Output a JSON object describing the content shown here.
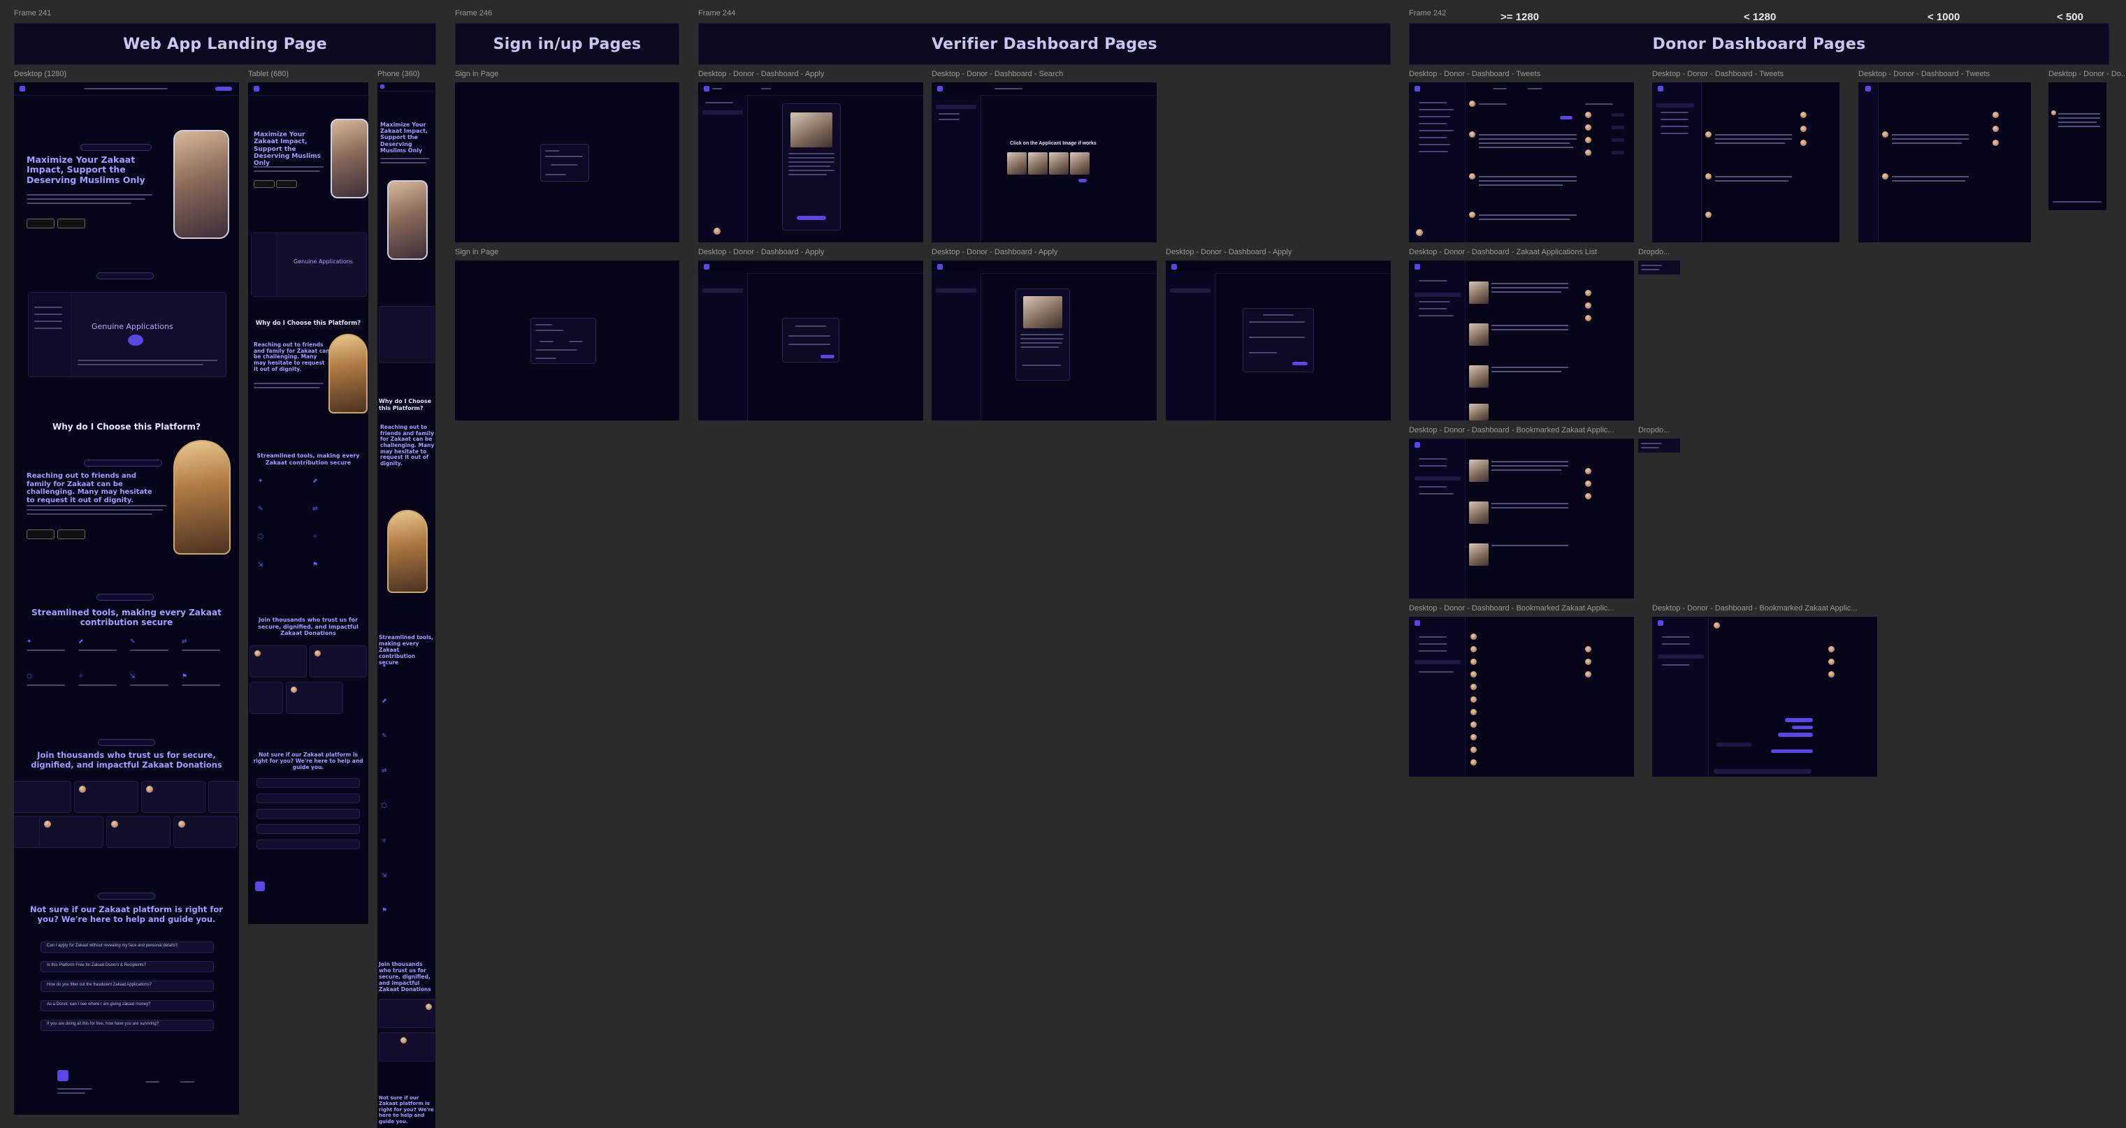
{
  "frames": {
    "f241": "Frame 241",
    "f246": "Frame 246",
    "f244": "Frame 244",
    "f242": "Frame 242"
  },
  "banners": {
    "landing": "Web App Landing Page",
    "signin": "Sign in/up Pages",
    "verifier": "Verifier Dashboard Pages",
    "donor": "Donor Dashboard Pages"
  },
  "breakpoints": [
    ">= 1280",
    "< 1280",
    "< 1000",
    "< 500"
  ],
  "screen_labels": {
    "desktop": "Desktop (1280)",
    "tablet": "Tablet (680)",
    "phone": "Phone (360)",
    "signin1": "Sign in Page",
    "signin2": "Sign in Page",
    "v_apply1": "Desktop - Donor - Dashboard - Apply",
    "v_search": "Desktop - Donor - Dashboard - Search",
    "v_apply2": "Desktop - Donor - Dashboard - Apply",
    "v_apply3": "Desktop - Donor - Dashboard - Apply",
    "v_apply4": "Desktop - Donor - Dashboard - Apply",
    "d_tweets1": "Desktop - Donor - Dashboard - Tweets",
    "d_tweets2": "Desktop - Donor - Dashboard - Tweets",
    "d_tweets3": "Desktop - Donor - Dashboard - Tweets",
    "d_tweets4": "Desktop - Donor - Do...",
    "d_list": "Desktop - Donor - Dashboard - Zakaat Applications List",
    "d_dropdown1": "Dropdo...",
    "d_bookmarked1": "Desktop - Donor - Dashboard - Bookmarked Zakaat Applic...",
    "d_dropdown2": "Dropdo...",
    "d_bookmarked2": "Desktop - Donor - Dashboard - Bookmarked Zakaat Applic...",
    "d_bookmarked3": "Desktop - Donor - Dashboard - Bookmarked Zakaat Applic..."
  },
  "landing": {
    "hero_title": "Maximize Your Zakaat Impact, Support the Deserving Muslims Only",
    "tablet_hero": "Maximize Your Zakaat Impact, Support the Deserving Muslims Only",
    "phone_hero": "Maximize Your Zakaat Impact, Support the Deserving Muslims Only",
    "genuine": "Genuine Applications",
    "why": "Why do I Choose this Platform?",
    "reaching": "Reaching out to friends and family for Zakaat can be challenging. Many may hesitate to request it out of dignity.",
    "tablet_reaching": "Reaching out to friends and family for Zakaat can be challenging. Many may hesitate to request it out of dignity.",
    "phone_reaching": "Reaching out to friends and family for Zakaat can be challenging. Many may hesitate to request it out of dignity.",
    "streamlined": "Streamlined tools, making every Zakaat contribution secure",
    "tablet_streamlined": "Streamlined tools, making every Zakaat contribution secure",
    "phone_streamlined": "Streamlined tools, making every Zakaat contribution secure",
    "join": "Join thousands who trust us for secure, dignified, and impactful Zakaat Donations",
    "tablet_join": "Join thousands who trust us for secure, dignified, and impactful Zakaat Donations",
    "phone_join": "Join thousands who trust us for secure, dignified, and impactful Zakaat Donations",
    "not_sure": "Not sure if our Zakaat platform is right for you? We're here to help and guide you.",
    "tablet_not_sure": "Not sure if our Zakaat platform is right for you? We're here to help and guide you.",
    "phone_not_sure": "Not sure if our Zakaat platform is right for you? We're here to help and guide you.",
    "phone_why": "Why do I Choose this Platform?",
    "tablet_why": "Why do I Choose this Platform?",
    "faqs": [
      "Can I apply for Zakaat without revealing my face and personal details?",
      "Is this Platform Free for Zakaat Donors & Recipients?",
      "How do you filter out the fraudulent Zakaat Applications?",
      "As a Donor, can I see where I am giving zakaat money?",
      "If you are doing all this for free, how have you are surviving?"
    ]
  },
  "verifier": {
    "search_prompt": "Click on the Applicant Image if works"
  },
  "colors": {
    "background": "#2b2b2b",
    "screen": "#07051a",
    "accent": "#5b46e6",
    "heading": "#a99bff"
  }
}
